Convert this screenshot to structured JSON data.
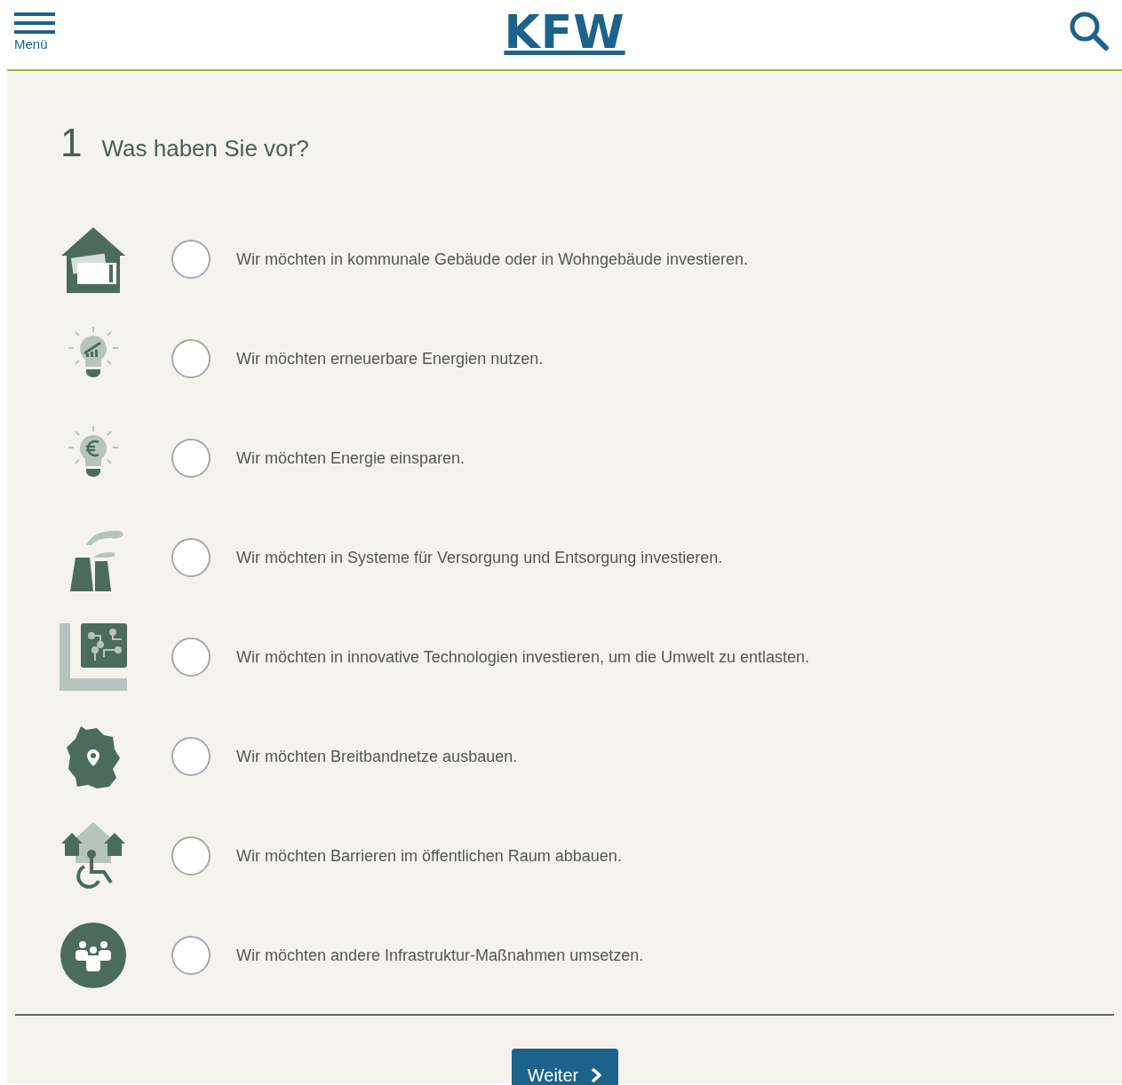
{
  "header": {
    "menu_label": "Menü",
    "logo": "KFW"
  },
  "question": {
    "number": "1",
    "title": "Was haben Sie vor?"
  },
  "options": [
    {
      "label": "Wir möchten in kommunale Gebäude oder in Wohngebäude investieren.",
      "selected": false
    },
    {
      "label": "Wir möchten erneuerbare Energien nutzen.",
      "selected": false
    },
    {
      "label": "Wir möchten Energie einsparen.",
      "selected": false
    },
    {
      "label": "Wir möchten in Systeme für Versorgung und Entsorgung investieren.",
      "selected": false
    },
    {
      "label": "Wir möchten in innovative Technologien investieren, um die Umwelt zu entlasten.",
      "selected": false
    },
    {
      "label": "Wir möchten Breitbandnetze ausbauen.",
      "selected": false
    },
    {
      "label": "Wir möchten Barrieren im öffentlichen Raum abbauen.",
      "selected": false
    },
    {
      "label": "Wir möchten andere Infrastruktur-Maßnahmen umsetzen.",
      "selected": false
    }
  ],
  "next_button": "Weiter"
}
